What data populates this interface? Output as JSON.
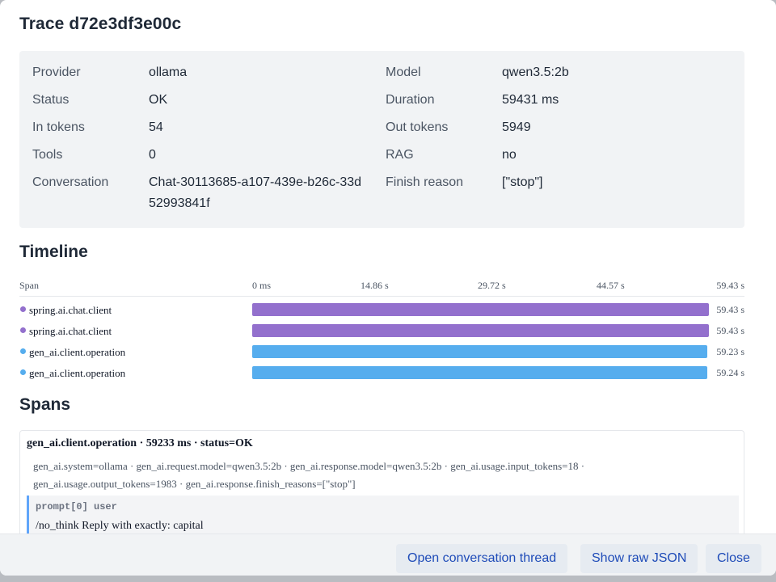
{
  "dialog": {
    "title": "Trace d72e3df3e00c"
  },
  "summary": {
    "provider_label": "Provider",
    "provider_value": "ollama",
    "model_label": "Model",
    "model_value": "qwen3.5:2b",
    "status_label": "Status",
    "status_value": "OK",
    "duration_label": "Duration",
    "duration_value": "59431 ms",
    "in_tokens_label": "In tokens",
    "in_tokens_value": "54",
    "out_tokens_label": "Out tokens",
    "out_tokens_value": "5949",
    "tools_label": "Tools",
    "tools_value": "0",
    "rag_label": "RAG",
    "rag_value": "no",
    "conversation_label": "Conversation",
    "conversation_value": "Chat-30113685-a107-439e-b26c-33d52993841f",
    "finish_reason_label": "Finish reason",
    "finish_reason_value": "[\"stop\"]"
  },
  "timeline": {
    "title": "Timeline",
    "span_header": "Span",
    "ticks": [
      "0 ms",
      "14.86 s",
      "29.72 s",
      "44.57 s",
      "59.43 s"
    ],
    "rows": [
      {
        "name": "spring.ai.chat.client",
        "duration": "59.43 s",
        "fraction": 1.0,
        "color": "#9370cd"
      },
      {
        "name": "spring.ai.chat.client",
        "duration": "59.43 s",
        "fraction": 1.0,
        "color": "#9370cd"
      },
      {
        "name": "gen_ai.client.operation",
        "duration": "59.23 s",
        "fraction": 0.9966,
        "color": "#56adee"
      },
      {
        "name": "gen_ai.client.operation",
        "duration": "59.24 s",
        "fraction": 0.9968,
        "color": "#56adee"
      }
    ]
  },
  "spans": {
    "title": "Spans",
    "card": {
      "header": "gen_ai.client.operation · 59233 ms · status=OK",
      "attributes": "gen_ai.system=ollama · gen_ai.request.model=qwen3.5:2b · gen_ai.response.model=qwen3.5:2b · gen_ai.usage.input_tokens=18 · gen_ai.usage.output_tokens=1983 · gen_ai.response.finish_reasons=[\"stop\"]",
      "message_role": "prompt[0] user",
      "message_text": "/no_think Reply with exactly: capital"
    }
  },
  "footer": {
    "open_thread_label": "Open conversation thread",
    "raw_json_label": "Show raw JSON",
    "close_label": "Close"
  }
}
